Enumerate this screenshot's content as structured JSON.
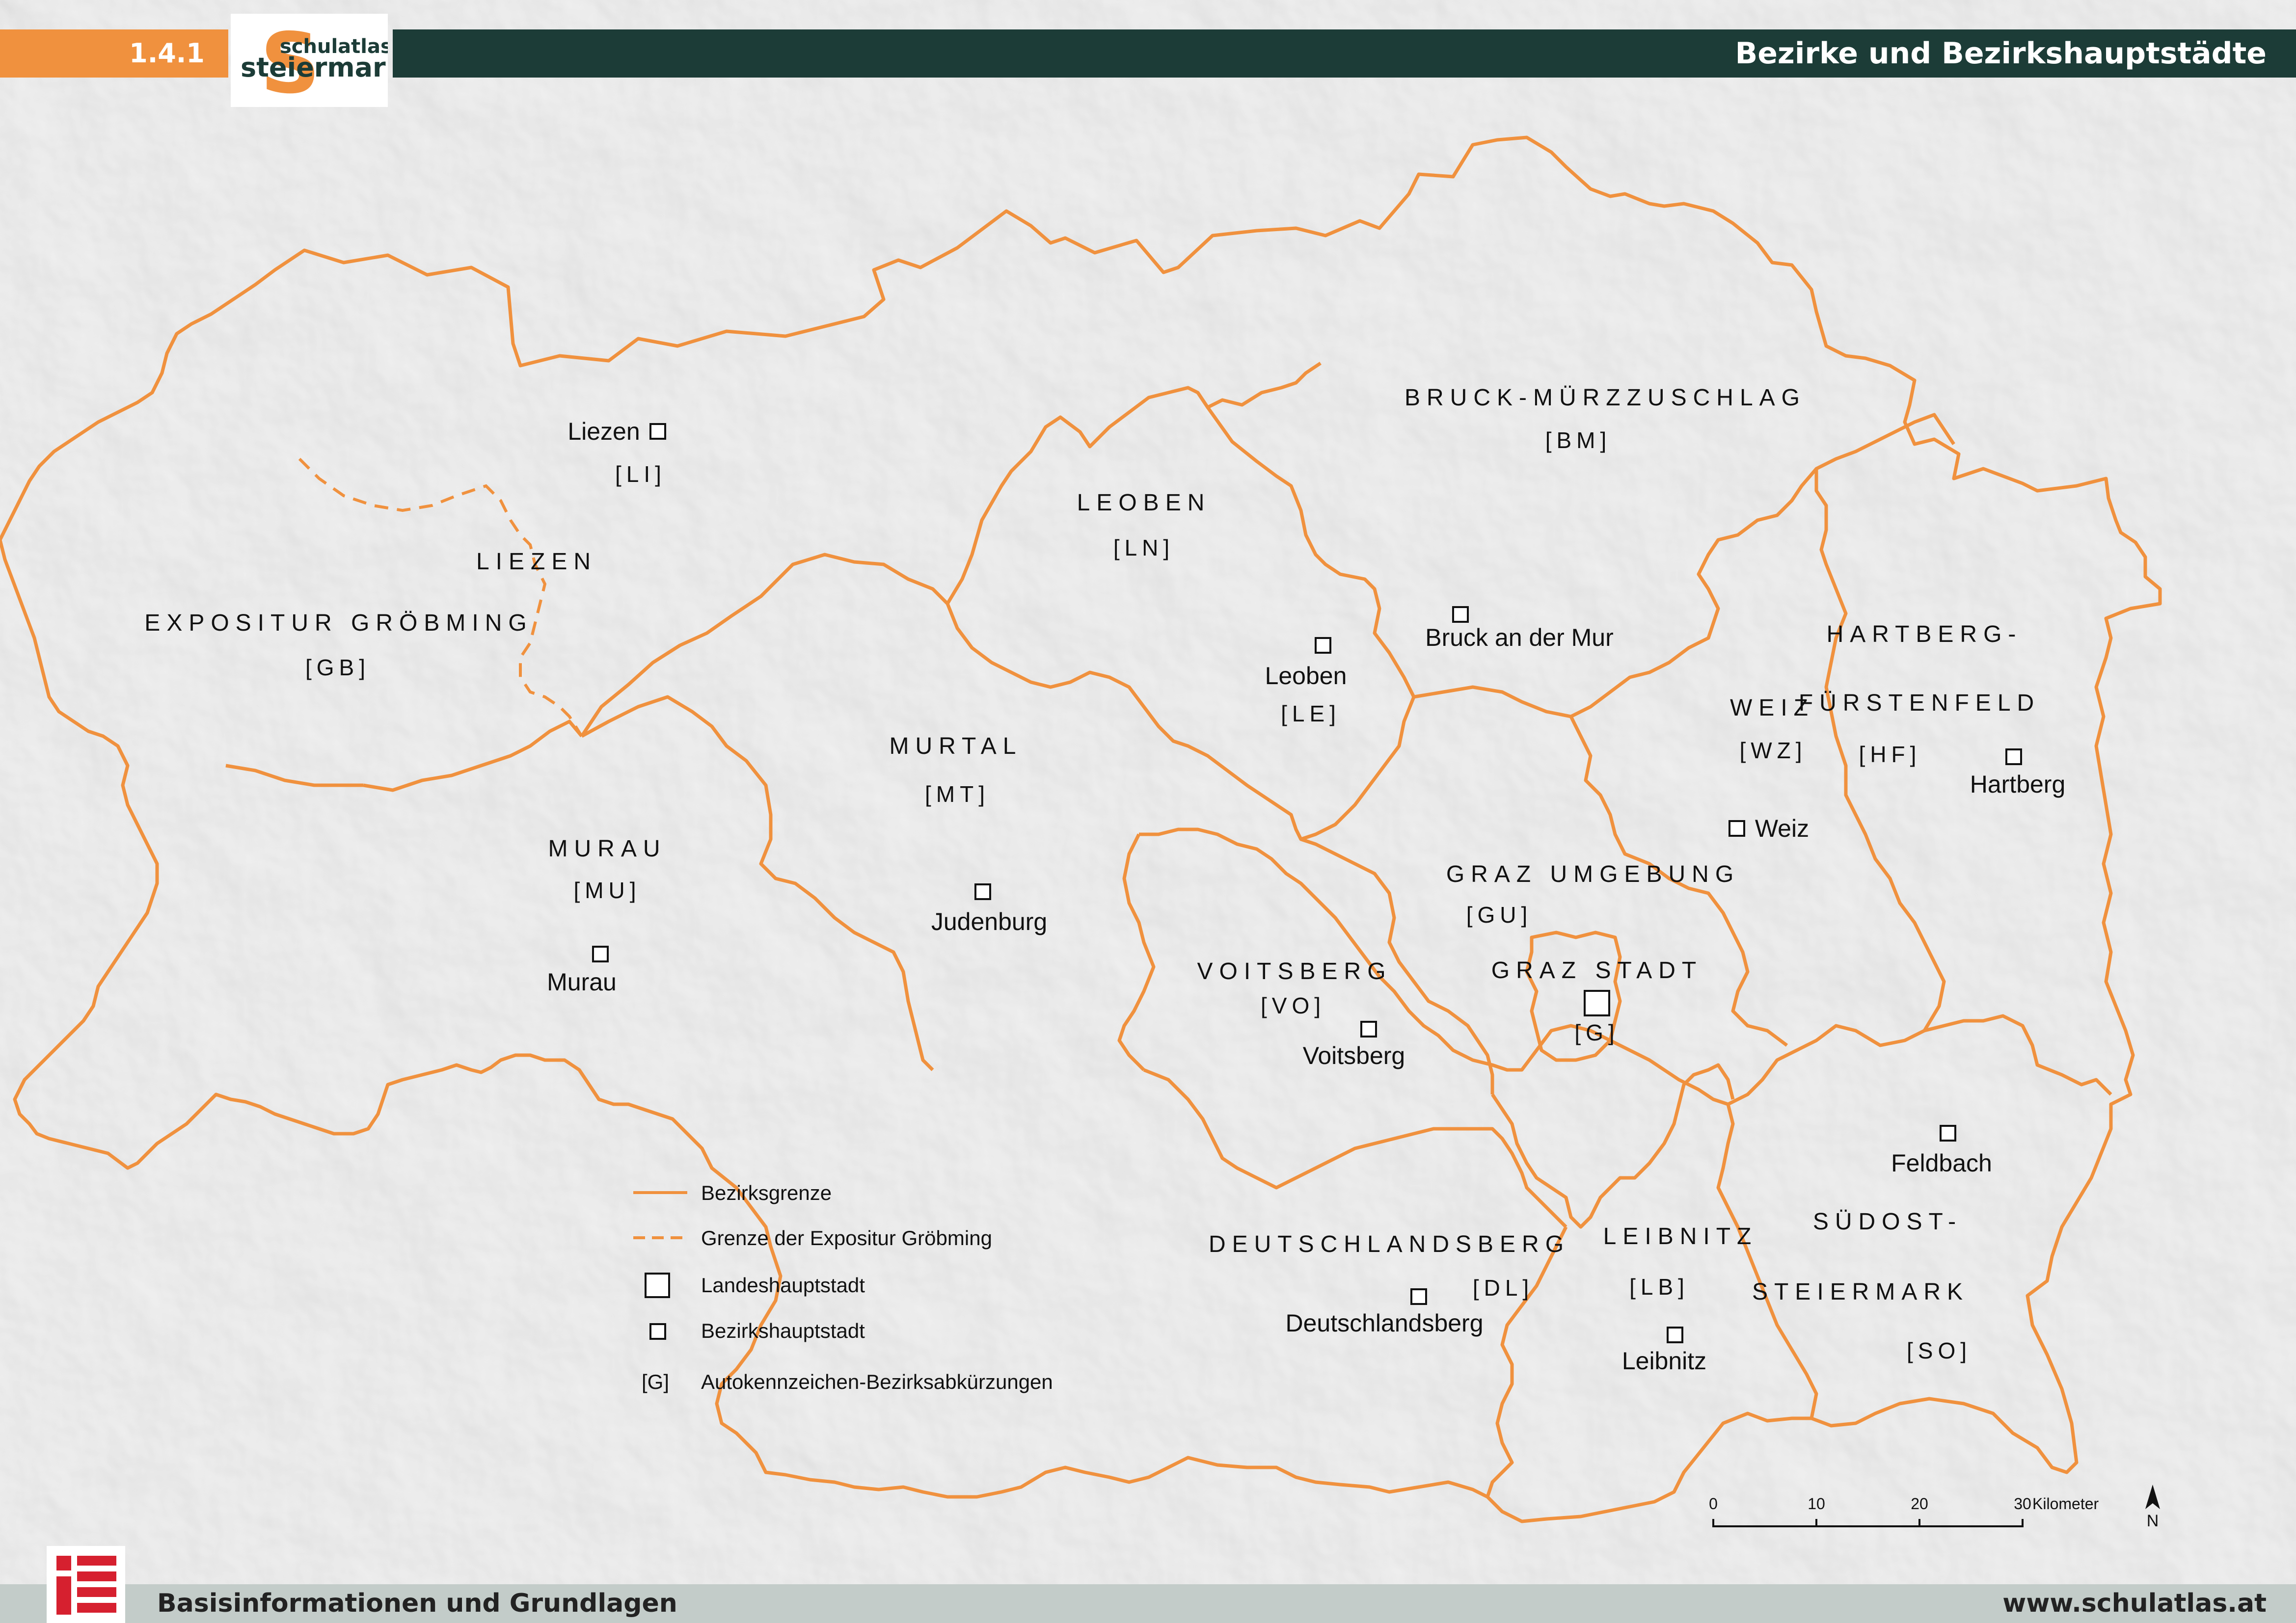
{
  "header": {
    "section_code": "1.4.1",
    "logo_text_top": "schulatlas",
    "logo_text_bottom": "steiermark",
    "logo_letter": "S",
    "title": "Bezirke und Bezirkshauptstädte"
  },
  "footer": {
    "left": "Basisinformationen und Grundlagen",
    "right": "www.schulatlas.at"
  },
  "colors": {
    "border": "#f0913e",
    "header_dark": "#1c3c37",
    "header_orange": "#f0913e",
    "footer": "#c3ccc9",
    "footer_icon": "#d6202f"
  },
  "districts": [
    {
      "id": "li",
      "name": "LIEZEN",
      "code": "[LI]"
    },
    {
      "id": "gb",
      "name": "EXPOSITUR GRÖBMING",
      "code": "[GB]"
    },
    {
      "id": "mu",
      "name": "MURAU",
      "code": "[MU]"
    },
    {
      "id": "mt",
      "name": "MURTAL",
      "code": "[MT]"
    },
    {
      "id": "ln",
      "name": "LEOBEN",
      "code": "[LN]"
    },
    {
      "id": "le",
      "name": "",
      "code": "[LE]"
    },
    {
      "id": "bm",
      "name": "BRUCK-MÜRZZUSCHLAG",
      "code": "[BM]"
    },
    {
      "id": "wz",
      "name": "WEIZ",
      "code": "[WZ]"
    },
    {
      "id": "hf",
      "name": "HARTBERG-",
      "name2": "FÜRSTENFELD",
      "code": "[HF]"
    },
    {
      "id": "gu",
      "name": "GRAZ UMGEBUNG",
      "code": "[GU]"
    },
    {
      "id": "g",
      "name": "GRAZ STADT",
      "code": "[G]"
    },
    {
      "id": "vo",
      "name": "VOITSBERG",
      "code": "[VO]"
    },
    {
      "id": "dl",
      "name": "DEUTSCHLANDSBERG",
      "code": "[DL]"
    },
    {
      "id": "lb",
      "name": "LEIBNITZ",
      "code": "[LB]"
    },
    {
      "id": "so",
      "name": "SÜDOST-",
      "name2": "STEIERMARK",
      "code": "[SO]"
    }
  ],
  "cities": [
    {
      "id": "liezen",
      "name": "Liezen",
      "type": "Bezirkshauptstadt"
    },
    {
      "id": "leoben",
      "name": "Leoben",
      "type": "Bezirkshauptstadt"
    },
    {
      "id": "bruck",
      "name": "Bruck an der Mur",
      "type": "Bezirkshauptstadt"
    },
    {
      "id": "weiz",
      "name": "Weiz",
      "type": "Bezirkshauptstadt"
    },
    {
      "id": "hartberg",
      "name": "Hartberg",
      "type": "Bezirkshauptstadt"
    },
    {
      "id": "murau",
      "name": "Murau",
      "type": "Bezirkshauptstadt"
    },
    {
      "id": "judenburg",
      "name": "Judenburg",
      "type": "Bezirkshauptstadt"
    },
    {
      "id": "voitsberg",
      "name": "Voitsberg",
      "type": "Bezirkshauptstadt"
    },
    {
      "id": "graz",
      "name": "",
      "type": "Landeshauptstadt"
    },
    {
      "id": "feldbach",
      "name": "Feldbach",
      "type": "Bezirkshauptstadt"
    },
    {
      "id": "deutschlandsberg",
      "name": "Deutschlandsberg",
      "type": "Bezirkshauptstadt"
    },
    {
      "id": "leibnitz",
      "name": "Leibnitz",
      "type": "Bezirkshauptstadt"
    }
  ],
  "legend": {
    "border": "Bezirksgrenze",
    "expositur": "Grenze der Expositur Gröbming",
    "capital": "Landeshauptstadt",
    "district_capital": "Bezirkshauptstadt",
    "code_sample": "[G]",
    "code": "Autokennzeichen-Bezirksabkürzungen"
  },
  "scale": {
    "ticks": [
      "0",
      "10",
      "20",
      "30"
    ],
    "unit": "Kilometer",
    "north": "N"
  }
}
